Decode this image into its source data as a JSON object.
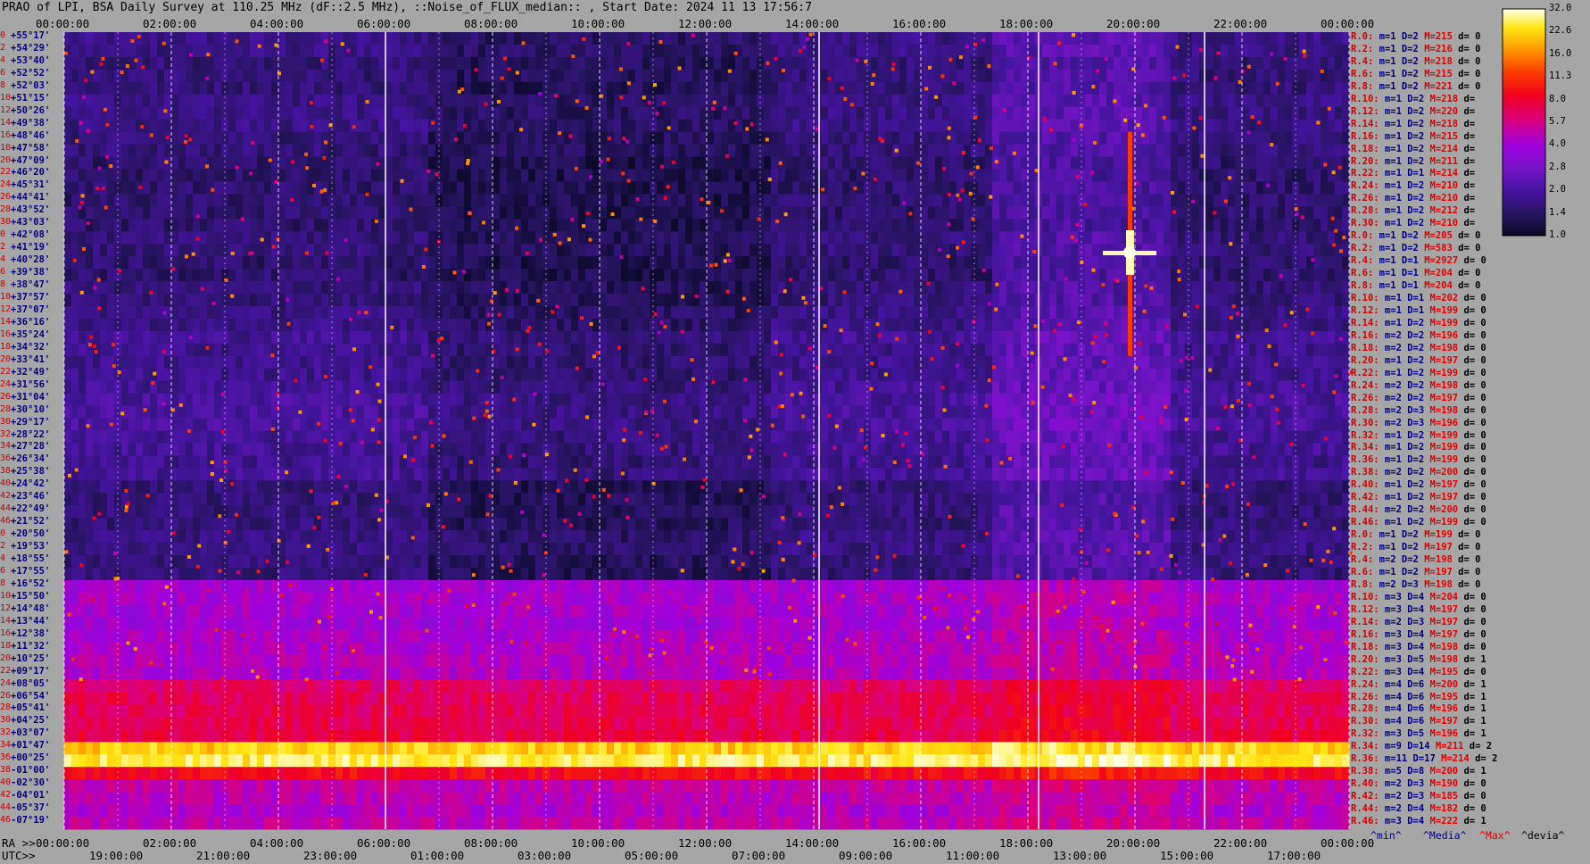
{
  "title": "PRAO of LPI, BSA Daily Survey at 110.25 MHz (dF::2.5 MHz), ::Noise_of_FLUX_median:: , Start Date: 2024 11 13 17:56:7",
  "colors": {
    "background": "#a6a6a6",
    "declination_label": "#000080",
    "row_index": "#c80000",
    "stat_max": "#e00000"
  },
  "chart_data": {
    "type": "heatmap",
    "title": "PRAO of LPI, BSA Daily Survey at 110.25 MHz (dF::2.5 MHz), ::Noise_of_FLUX_median:: , Start Date: 2024 11 13 17:56:7",
    "top_ticks": [
      "00:00:00",
      "02:00:00",
      "04:00:00",
      "06:00:00",
      "08:00:00",
      "10:00:00",
      "12:00:00",
      "14:00:00",
      "16:00:00",
      "18:00:00",
      "20:00:00",
      "22:00:00",
      "00:00:00"
    ],
    "bottom_ra_label": "RA >>",
    "bottom_ra_ticks": [
      "00:00:00",
      "02:00:00",
      "04:00:00",
      "06:00:00",
      "08:00:00",
      "10:00:00",
      "12:00:00",
      "14:00:00",
      "16:00:00",
      "18:00:00",
      "20:00:00",
      "22:00:00",
      "00:00:00"
    ],
    "bottom_utc_label": "UTC>>",
    "bottom_utc_ticks": [
      "19:00:00",
      "21:00:00",
      "23:00:00",
      "01:00:00",
      "03:00:00",
      "05:00:00",
      "07:00:00",
      "09:00:00",
      "11:00:00",
      "13:00:00",
      "15:00:00",
      "17:00:00"
    ],
    "declinations": [
      "+55°17'",
      "+54°29'",
      "+53°40'",
      "+52°52'",
      "+52°03'",
      "+51°15'",
      "+50°26'",
      "+49°38'",
      "+48°46'",
      "+47°58'",
      "+47°09'",
      "+46°20'",
      "+45°31'",
      "+44°41'",
      "+43°52'",
      "+43°03'",
      "+42°08'",
      "+41°19'",
      "+40°28'",
      "+39°38'",
      "+38°47'",
      "+37°57'",
      "+37°07'",
      "+36°16'",
      "+35°24'",
      "+34°32'",
      "+33°41'",
      "+32°49'",
      "+31°56'",
      "+31°04'",
      "+30°10'",
      "+29°17'",
      "+28°22'",
      "+27°28'",
      "+26°34'",
      "+25°38'",
      "+24°42'",
      "+23°46'",
      "+22°49'",
      "+21°52'",
      "+20°50'",
      "+19°53'",
      "+18°55'",
      "+17°55'",
      "+16°52'",
      "+15°50'",
      "+14°48'",
      "+13°44'",
      "+12°38'",
      "+11°32'",
      "+10°25'",
      "+09°17'",
      "+08°05'",
      "+06°54'",
      "+05°41'",
      "+04°25'",
      "+03°07'",
      "+01°47'",
      "+00°25'",
      "-01°00'",
      "-02°30'",
      "-04°01'",
      "-05°37'",
      "-07°19'"
    ],
    "row_index": [
      "0",
      "2",
      "4",
      "6",
      "8",
      "10",
      "12",
      "14",
      "16",
      "18",
      "20",
      "22",
      "24",
      "26",
      "28",
      "30",
      "0",
      "2",
      "4",
      "6",
      "8",
      "10",
      "12",
      "14",
      "16",
      "18",
      "20",
      "22",
      "24",
      "26",
      "28",
      "30",
      "32",
      "34",
      "36",
      "38",
      "40",
      "42",
      "44",
      "46",
      "0",
      "2",
      "4",
      "6",
      "8",
      "10",
      "12",
      "14",
      "16",
      "18",
      "20",
      "22",
      "24",
      "26",
      "28",
      "30",
      "32",
      "34",
      "36",
      "38",
      "40",
      "42",
      "44",
      "46"
    ],
    "stats": [
      {
        "r": "R.0:",
        "m": "m=1",
        "d": "D=2",
        "max": "M=215",
        "dev": "d= 0"
      },
      {
        "r": "R.2:",
        "m": "m=1",
        "d": "D=2",
        "max": "M=216",
        "dev": "d= 0"
      },
      {
        "r": "R.4:",
        "m": "m=1",
        "d": "D=2",
        "max": "M=218",
        "dev": "d= 0"
      },
      {
        "r": "R.6:",
        "m": "m=1",
        "d": "D=2",
        "max": "M=215",
        "dev": "d= 0"
      },
      {
        "r": "R.8:",
        "m": "m=1",
        "d": "D=2",
        "max": "M=221",
        "dev": "d= 0"
      },
      {
        "r": "R.10:",
        "m": "m=1",
        "d": "D=2",
        "max": "M=218",
        "dev": "d="
      },
      {
        "r": "R.12:",
        "m": "m=1",
        "d": "D=2",
        "max": "M=220",
        "dev": "d="
      },
      {
        "r": "R.14:",
        "m": "m=1",
        "d": "D=2",
        "max": "M=218",
        "dev": "d="
      },
      {
        "r": "R.16:",
        "m": "m=1",
        "d": "D=2",
        "max": "M=215",
        "dev": "d="
      },
      {
        "r": "R.18:",
        "m": "m=1",
        "d": "D=2",
        "max": "M=214",
        "dev": "d="
      },
      {
        "r": "R.20:",
        "m": "m=1",
        "d": "D=2",
        "max": "M=211",
        "dev": "d="
      },
      {
        "r": "R.22:",
        "m": "m=1",
        "d": "D=1",
        "max": "M=214",
        "dev": "d="
      },
      {
        "r": "R.24:",
        "m": "m=1",
        "d": "D=2",
        "max": "M=210",
        "dev": "d="
      },
      {
        "r": "R.26:",
        "m": "m=1",
        "d": "D=2",
        "max": "M=210",
        "dev": "d="
      },
      {
        "r": "R.28:",
        "m": "m=1",
        "d": "D=2",
        "max": "M=212",
        "dev": "d="
      },
      {
        "r": "R.30:",
        "m": "m=1",
        "d": "D=2",
        "max": "M=210",
        "dev": "d="
      },
      {
        "r": "R.0:",
        "m": "m=1",
        "d": "D=2",
        "max": "M=205",
        "dev": "d= 0"
      },
      {
        "r": "R.2:",
        "m": "m=1",
        "d": "D=2",
        "max": "M=583",
        "dev": "d= 0"
      },
      {
        "r": "R.4:",
        "m": "m=1",
        "d": "D=1",
        "max": "M=2927",
        "dev": "d= 0"
      },
      {
        "r": "R.6:",
        "m": "m=1",
        "d": "D=1",
        "max": "M=204",
        "dev": "d= 0"
      },
      {
        "r": "R.8:",
        "m": "m=1",
        "d": "D=1",
        "max": "M=204",
        "dev": "d= 0"
      },
      {
        "r": "R.10:",
        "m": "m=1",
        "d": "D=1",
        "max": "M=202",
        "dev": "d= 0"
      },
      {
        "r": "R.12:",
        "m": "m=1",
        "d": "D=1",
        "max": "M=199",
        "dev": "d= 0"
      },
      {
        "r": "R.14:",
        "m": "m=1",
        "d": "D=2",
        "max": "M=199",
        "dev": "d= 0"
      },
      {
        "r": "R.16:",
        "m": "m=2",
        "d": "D=2",
        "max": "M=196",
        "dev": "d= 0"
      },
      {
        "r": "R.18:",
        "m": "m=2",
        "d": "D=2",
        "max": "M=198",
        "dev": "d= 0"
      },
      {
        "r": "R.20:",
        "m": "m=1",
        "d": "D=2",
        "max": "M=197",
        "dev": "d= 0"
      },
      {
        "r": "R.22:",
        "m": "m=1",
        "d": "D=2",
        "max": "M=199",
        "dev": "d= 0"
      },
      {
        "r": "R.24:",
        "m": "m=2",
        "d": "D=2",
        "max": "M=198",
        "dev": "d= 0"
      },
      {
        "r": "R.26:",
        "m": "m=2",
        "d": "D=2",
        "max": "M=197",
        "dev": "d= 0"
      },
      {
        "r": "R.28:",
        "m": "m=2",
        "d": "D=3",
        "max": "M=198",
        "dev": "d= 0"
      },
      {
        "r": "R.30:",
        "m": "m=2",
        "d": "D=3",
        "max": "M=196",
        "dev": "d= 0"
      },
      {
        "r": "R.32:",
        "m": "m=1",
        "d": "D=2",
        "max": "M=199",
        "dev": "d= 0"
      },
      {
        "r": "R.34:",
        "m": "m=1",
        "d": "D=2",
        "max": "M=199",
        "dev": "d= 0"
      },
      {
        "r": "R.36:",
        "m": "m=1",
        "d": "D=2",
        "max": "M=199",
        "dev": "d= 0"
      },
      {
        "r": "R.38:",
        "m": "m=2",
        "d": "D=2",
        "max": "M=200",
        "dev": "d= 0"
      },
      {
        "r": "R.40:",
        "m": "m=1",
        "d": "D=2",
        "max": "M=197",
        "dev": "d= 0"
      },
      {
        "r": "R.42:",
        "m": "m=1",
        "d": "D=2",
        "max": "M=197",
        "dev": "d= 0"
      },
      {
        "r": "R.44:",
        "m": "m=2",
        "d": "D=2",
        "max": "M=200",
        "dev": "d= 0"
      },
      {
        "r": "R.46:",
        "m": "m=1",
        "d": "D=2",
        "max": "M=199",
        "dev": "d= 0"
      },
      {
        "r": "R.0:",
        "m": "m=1",
        "d": "D=2",
        "max": "M=199",
        "dev": "d= 0"
      },
      {
        "r": "R.2:",
        "m": "m=1",
        "d": "D=2",
        "max": "M=197",
        "dev": "d= 0"
      },
      {
        "r": "R.4:",
        "m": "m=2",
        "d": "D=2",
        "max": "M=198",
        "dev": "d= 0"
      },
      {
        "r": "R.6:",
        "m": "m=1",
        "d": "D=2",
        "max": "M=197",
        "dev": "d= 0"
      },
      {
        "r": "R.8:",
        "m": "m=2",
        "d": "D=3",
        "max": "M=198",
        "dev": "d= 0"
      },
      {
        "r": "R.10:",
        "m": "m=3",
        "d": "D=4",
        "max": "M=204",
        "dev": "d= 0"
      },
      {
        "r": "R.12:",
        "m": "m=3",
        "d": "D=4",
        "max": "M=197",
        "dev": "d= 0"
      },
      {
        "r": "R.14:",
        "m": "m=2",
        "d": "D=3",
        "max": "M=197",
        "dev": "d= 0"
      },
      {
        "r": "R.16:",
        "m": "m=3",
        "d": "D=4",
        "max": "M=197",
        "dev": "d= 0"
      },
      {
        "r": "R.18:",
        "m": "m=3",
        "d": "D=4",
        "max": "M=198",
        "dev": "d= 0"
      },
      {
        "r": "R.20:",
        "m": "m=3",
        "d": "D=5",
        "max": "M=198",
        "dev": "d= 1"
      },
      {
        "r": "R.22:",
        "m": "m=3",
        "d": "D=4",
        "max": "M=195",
        "dev": "d= 0"
      },
      {
        "r": "R.24:",
        "m": "m=4",
        "d": "D=6",
        "max": "M=200",
        "dev": "d= 1"
      },
      {
        "r": "R.26:",
        "m": "m=4",
        "d": "D=6",
        "max": "M=195",
        "dev": "d= 1"
      },
      {
        "r": "R.28:",
        "m": "m=4",
        "d": "D=6",
        "max": "M=196",
        "dev": "d= 1"
      },
      {
        "r": "R.30:",
        "m": "m=4",
        "d": "D=6",
        "max": "M=197",
        "dev": "d= 1"
      },
      {
        "r": "R.32:",
        "m": "m=3",
        "d": "D=5",
        "max": "M=196",
        "dev": "d= 1"
      },
      {
        "r": "R.34:",
        "m": "m=9",
        "d": "D=14",
        "max": "M=211",
        "dev": "d= 2"
      },
      {
        "r": "R.36:",
        "m": "m=11",
        "d": "D=17",
        "max": "M=214",
        "dev": "d= 2"
      },
      {
        "r": "R.38:",
        "m": "m=5",
        "d": "D=8",
        "max": "M=200",
        "dev": "d= 1"
      },
      {
        "r": "R.40:",
        "m": "m=2",
        "d": "D=3",
        "max": "M=190",
        "dev": "d= 0"
      },
      {
        "r": "R.42:",
        "m": "m=2",
        "d": "D=3",
        "max": "M=185",
        "dev": "d= 0"
      },
      {
        "r": "R.44:",
        "m": "m=2",
        "d": "D=4",
        "max": "M=182",
        "dev": "d= 0"
      },
      {
        "r": "R.46:",
        "m": "m=3",
        "d": "D=4",
        "max": "M=222",
        "dev": "d= 1"
      }
    ],
    "stat_footer": {
      "min": "^min^",
      "median": "^Media^",
      "max": "^Max^",
      "dev": "^devia^"
    },
    "colorbar": {
      "ticks": [
        "32.0",
        "22.6",
        "16.0",
        "11.3",
        "8.0",
        "5.7",
        "4.0",
        "2.8",
        "2.0",
        "1.4",
        "1.0"
      ],
      "range": [
        1.0,
        32.0
      ],
      "scale": "log"
    },
    "row_levels": [
      1.7,
      1.7,
      1.6,
      1.6,
      1.6,
      1.7,
      1.7,
      1.7,
      1.6,
      1.6,
      1.5,
      1.5,
      1.5,
      1.5,
      1.5,
      1.5,
      1.6,
      1.6,
      1.5,
      1.5,
      1.6,
      1.6,
      1.7,
      1.7,
      1.9,
      1.8,
      1.8,
      1.8,
      1.9,
      2.0,
      2.0,
      2.0,
      1.9,
      1.9,
      1.8,
      1.9,
      1.6,
      1.6,
      1.6,
      1.6,
      1.7,
      1.7,
      1.6,
      1.6,
      4.0,
      4.2,
      4.2,
      4.0,
      4.3,
      4.4,
      4.6,
      4.4,
      6.5,
      7.0,
      7.0,
      7.2,
      7.5,
      22.0,
      26.0,
      9.0,
      5.0,
      4.8,
      4.5,
      5.0
    ]
  }
}
